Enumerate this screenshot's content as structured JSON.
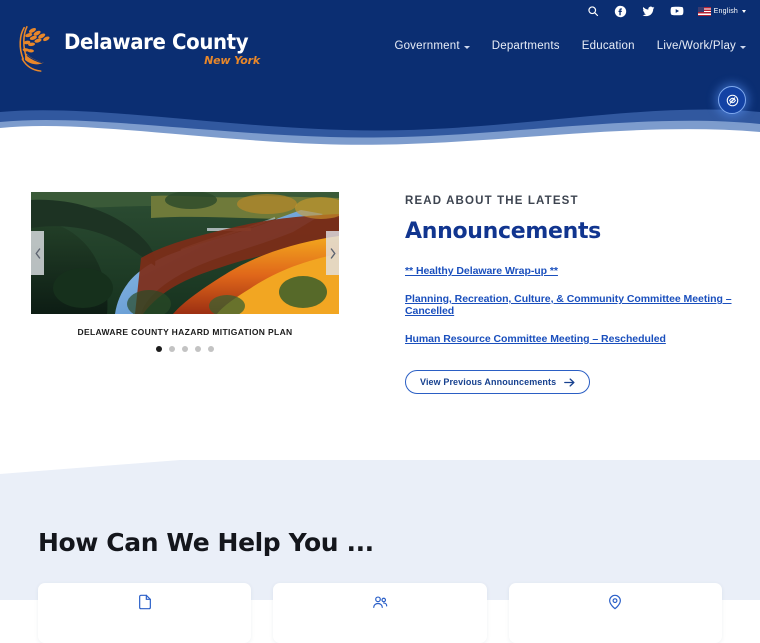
{
  "site": {
    "logo_title": "Delaware County",
    "logo_subtitle": "New York"
  },
  "topbar": {
    "icons": [
      {
        "name": "search-icon",
        "label": "Search"
      },
      {
        "name": "facebook-icon",
        "label": "Facebook"
      },
      {
        "name": "twitter-icon",
        "label": "Twitter"
      },
      {
        "name": "youtube-icon",
        "label": "YouTube"
      }
    ],
    "language": {
      "label": "English",
      "flag": "us-flag-icon"
    }
  },
  "mainnav": {
    "items": [
      {
        "label": "Government",
        "has_dropdown": true
      },
      {
        "label": "Departments",
        "has_dropdown": false
      },
      {
        "label": "Education",
        "has_dropdown": false
      },
      {
        "label": "Live/Work/Play",
        "has_dropdown": true
      }
    ]
  },
  "accessibility": {
    "icon": "accessibility-eye-slash-icon",
    "label": "Accessibility Options"
  },
  "carousel": {
    "caption": "DELAWARE COUNTY HAZARD MITIGATION PLAN",
    "slide_count": 5,
    "active_slide": 1,
    "prev_label": "Previous slide",
    "next_label": "Next slide"
  },
  "announcements": {
    "eyebrow": "READ ABOUT THE LATEST",
    "title": "Announcements",
    "links": [
      "** Healthy Delaware Wrap-up **",
      "Planning, Recreation, Culture, & Community Committee Meeting – Cancelled",
      "Human Resource Committee Meeting – Rescheduled"
    ],
    "button_label": "View Previous Announcements",
    "button_icon": "arrow-right-icon"
  },
  "help": {
    "title": "How Can We Help You ...",
    "cards": [
      {
        "icon": "card-icon-1"
      },
      {
        "icon": "card-icon-2"
      },
      {
        "icon": "card-icon-3"
      }
    ]
  },
  "colors": {
    "navy": "#0b2e72",
    "navy_deep": "#092457",
    "accent_orange": "#e8872a",
    "link_blue": "#1a4fbd",
    "heading_blue": "#11358f",
    "section_bg": "#eaeff8"
  }
}
